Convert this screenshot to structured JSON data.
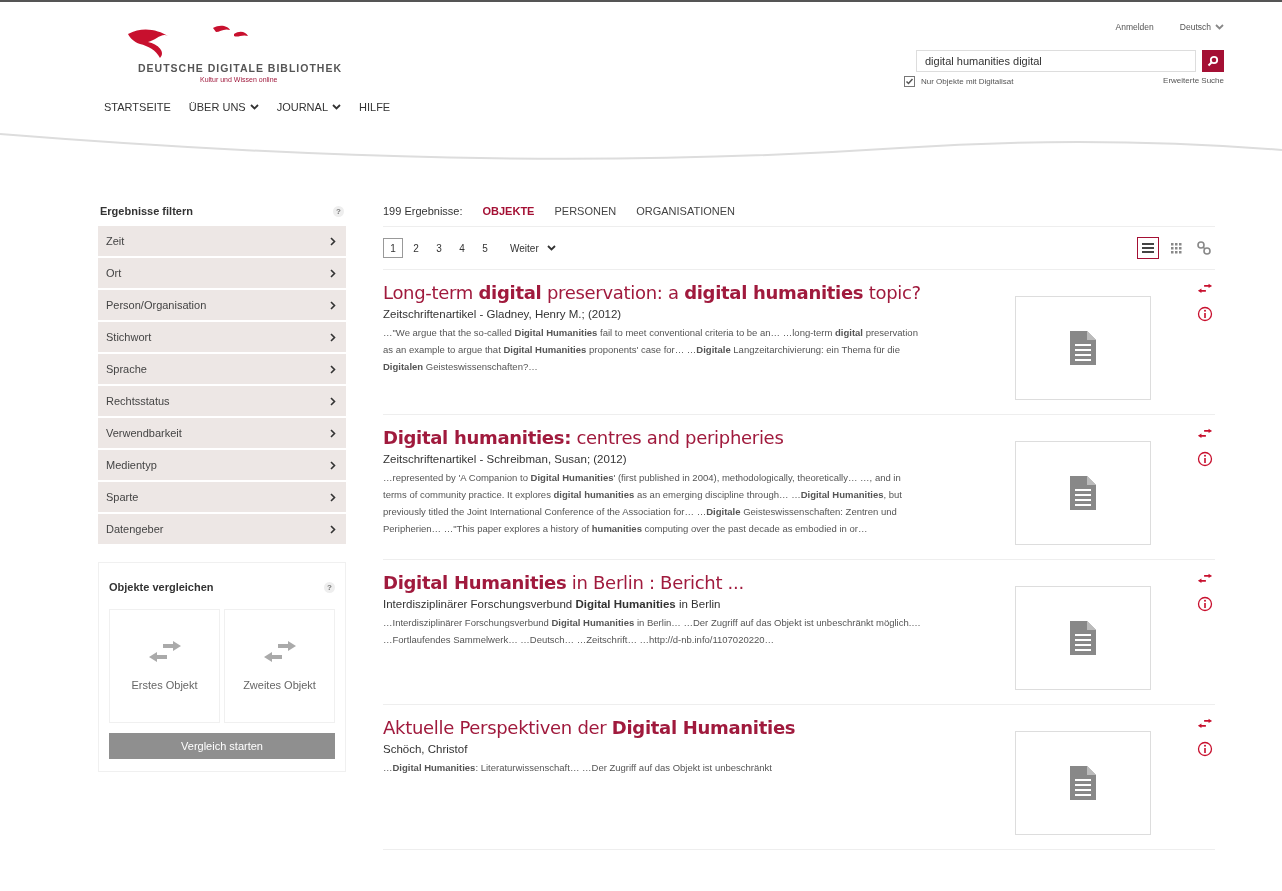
{
  "header": {
    "logo_title": "DEUTSCHE DIGITALE BIBLIOTHEK",
    "logo_subtitle": "Kultur und Wissen online",
    "nav": [
      {
        "label": "STARTSEITE",
        "dropdown": false
      },
      {
        "label": "ÜBER UNS",
        "dropdown": true
      },
      {
        "label": "JOURNAL",
        "dropdown": true
      },
      {
        "label": "HILFE",
        "dropdown": false
      }
    ],
    "login": "Anmelden",
    "language": "Deutsch",
    "search_value": "digital humanities digital",
    "digital_only": {
      "label": "Nur Objekte mit Digitalisat",
      "checked": true
    },
    "advanced_search": "Erweiterte Suche"
  },
  "filters": {
    "title": "Ergebnisse filtern",
    "help": "?",
    "items": [
      "Zeit",
      "Ort",
      "Person/Organisation",
      "Stichwort",
      "Sprache",
      "Rechtsstatus",
      "Verwendbarkeit",
      "Medientyp",
      "Sparte",
      "Datengeber"
    ]
  },
  "compare": {
    "title": "Objekte vergleichen",
    "help": "?",
    "slots": [
      "Erstes Objekt",
      "Zweites Objekt"
    ],
    "button": {
      "label": "Vergleich starten",
      "disabled": true
    }
  },
  "results": {
    "count": "199 Ergebnisse:",
    "tabs": [
      {
        "label": "OBJEKTE",
        "selected": true
      },
      {
        "label": "PERSONEN",
        "selected": false
      },
      {
        "label": "ORGANISATIONEN",
        "selected": false
      }
    ],
    "pages": [
      {
        "label": "1",
        "selected": true
      },
      {
        "label": "2",
        "selected": false
      },
      {
        "label": "3",
        "selected": false
      },
      {
        "label": "4",
        "selected": false
      },
      {
        "label": "5",
        "selected": false
      }
    ],
    "next": "Weiter",
    "views": [
      {
        "kind": "list",
        "selected": true
      },
      {
        "kind": "grid",
        "selected": false
      },
      {
        "kind": "nodes",
        "selected": false
      }
    ],
    "items": [
      {
        "title": "Long-term **digital** preservation: a **digital humanities** topic?",
        "meta": "Zeitschriftenartikel - Gladney, Henry M.; (2012)",
        "snippet": "…\"We argue that the so-called **Digital Humanities** fail to meet conventional criteria to be an… …long-term **digital** preservation as an example to argue that **Digital Humanities** proponents' case for… …**Digitale** Langzeitarchivierung: ein Thema für die **Digitalen** Geisteswissenschaften?…"
      },
      {
        "title": "**Digital humanities:** centres and peripheries",
        "meta": "Zeitschriftenartikel - Schreibman, Susan; (2012)",
        "snippet": "…represented by 'A Companion to **Digital Humanities**' (first published in 2004), methodologically, theoretically… …, and in terms of community practice. It explores **digital humanities** as an emerging discipline through… …**Digital Humanities**, but previously titled the Joint International Conference of the Association for… …**Digitale** Geisteswissenschaften: Zentren und Peripherien… …\"This paper explores a history of **humanities** computing over the past decade as embodied in or…"
      },
      {
        "title": "**Digital Humanities** in Berlin : Bericht ...",
        "meta": "Interdisziplinärer Forschungsverbund **Digital Humanities** in Berlin",
        "snippet": "…Interdisziplinärer Forschungsverbund **Digital Humanities** in Berlin… …Der Zugriff auf das Objekt ist unbeschränkt möglich.… …Fortlaufendes Sammelwerk… …Deutsch… …Zeitschrift… …http://d-nb.info/1107020220…"
      },
      {
        "title": "Aktuelle Perspektiven der **Digital Humanities**",
        "meta": "Schöch, Christof",
        "snippet": "…**Digital Humanities**: Literaturwissenschaft… …Der Zugriff auf das Objekt ist unbeschränkt"
      }
    ]
  }
}
